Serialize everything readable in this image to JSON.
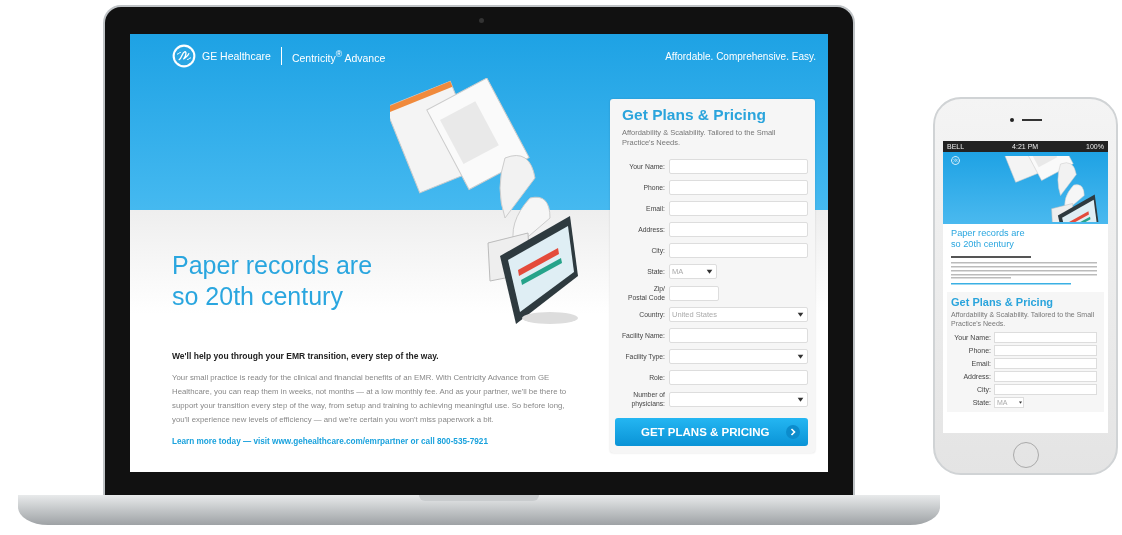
{
  "laptop": {
    "header": {
      "brand": "GE Healthcare",
      "product": "Centricity$^{®}$ Advance",
      "tagline": "Affordable. Comprehensive. Easy."
    },
    "hero": {
      "headline": "Paper records are so 20th century"
    },
    "intro": {
      "lead": "We'll help you through your EMR transition, every step of the way.",
      "body": "Your small practice is ready for the clinical and financial benefits of an EMR. With Centricity Advance from GE Healthcare, you can reap them in weeks, not months — at a low monthly fee. And as your partner, we'll be there to support your transition every step of the way, from setup and training to achieving meaningful use. So before long, you'll experience new levels of efficiency — and we're certain you won't miss paperwork a bit.",
      "link": "Learn more today — visit www.gehealthcare.com/emrpartner or call 800-535-7921"
    },
    "form": {
      "title": "Get Plans & Pricing",
      "subtitle": "Affordability & Scalability. Tailored to the Small Practice's Needs.",
      "fields": [
        {
          "label": "Your Name:",
          "kind": "text"
        },
        {
          "label": "Phone:",
          "kind": "text"
        },
        {
          "label": "Email:",
          "kind": "text"
        },
        {
          "label": "Address:",
          "kind": "text"
        },
        {
          "label": "City:",
          "kind": "text"
        },
        {
          "label": "State:",
          "kind": "small-select",
          "value": "MA"
        },
        {
          "label": "Zip/\nPostal Code",
          "kind": "short"
        },
        {
          "label": "Country:",
          "kind": "select",
          "value": "United States"
        },
        {
          "label": "Facility Name:",
          "kind": "text"
        },
        {
          "label": "Facility Type:",
          "kind": "select"
        },
        {
          "label": "Role:",
          "kind": "text"
        },
        {
          "label": "Number of\nphysicians:",
          "kind": "select"
        }
      ],
      "button": "GET PLANS & PRICING"
    }
  },
  "phone": {
    "status": {
      "carrier": "BELL",
      "time": "4:21 PM",
      "battery": "100%"
    },
    "headline": "Paper records are so 20th century",
    "form": {
      "title": "Get Plans & Pricing",
      "subtitle": "Affordability & Scalability. Tailored to the Small Practice's Needs.",
      "fields": [
        {
          "label": "Your Name:",
          "kind": "text"
        },
        {
          "label": "Phone:",
          "kind": "text"
        },
        {
          "label": "Email:",
          "kind": "text"
        },
        {
          "label": "Address:",
          "kind": "text"
        },
        {
          "label": "City:",
          "kind": "text"
        },
        {
          "label": "State:",
          "kind": "small-select",
          "value": "MA"
        }
      ]
    }
  }
}
